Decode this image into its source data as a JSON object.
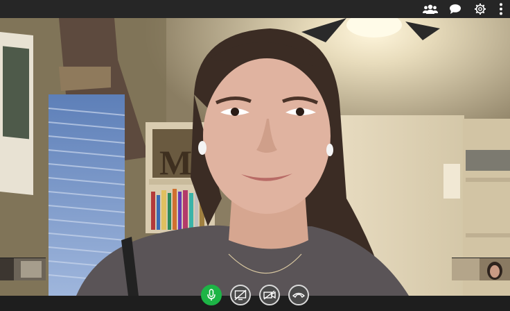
{
  "colors": {
    "topbar_bg": "#262626",
    "control_bar_bg": "#1e1e1e",
    "mic_active": "#1db446",
    "button_gray": "#4a4a4a"
  },
  "topbar": {
    "icons": [
      "participants-icon",
      "chat-icon",
      "settings-icon",
      "more-options-icon"
    ]
  },
  "controls": {
    "buttons": [
      {
        "name": "microphone-button",
        "icon": "microphone-icon",
        "state": "on"
      },
      {
        "name": "screen-share-button",
        "icon": "screen-share-off-icon",
        "state": "off"
      },
      {
        "name": "camera-button",
        "icon": "camera-off-icon",
        "state": "off"
      },
      {
        "name": "hang-up-button",
        "icon": "phone-hangup-icon",
        "state": "idle"
      }
    ]
  }
}
